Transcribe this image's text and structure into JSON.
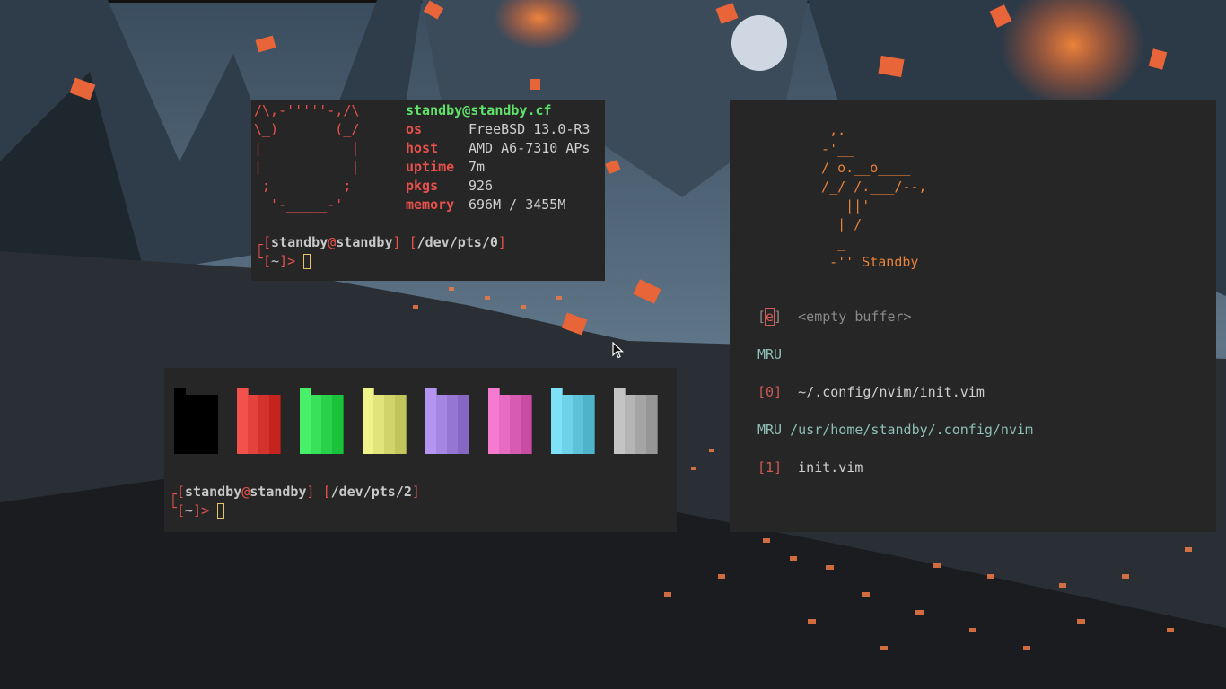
{
  "fetch": {
    "ascii": [
      "/\\,-'''''-,/\\",
      "\\_)       (_/",
      "|           |",
      "|           |",
      " ;         ;",
      "  '-_____-'"
    ],
    "user_host": "standby@standby.cf",
    "rows": [
      {
        "key": "os",
        "value": "FreeBSD 13.0-R3"
      },
      {
        "key": "host",
        "value": "AMD A6-7310 APs"
      },
      {
        "key": "uptime",
        "value": "7m"
      },
      {
        "key": "pkgs",
        "value": "926"
      },
      {
        "key": "memory",
        "value": "696M / 3455M"
      }
    ],
    "prompt": {
      "user": "standby",
      "host": "standby",
      "tty": "/dev/pts/0",
      "cwd": "~"
    }
  },
  "palette": {
    "colors": [
      "#000000",
      "#f2514c",
      "#48f06a",
      "#f0f38a",
      "#b595f2",
      "#f57ad0",
      "#7de2f7",
      "#c4c4c4"
    ],
    "prompt": {
      "user": "standby",
      "host": "standby",
      "tty": "/dev/pts/2",
      "cwd": "~"
    }
  },
  "nvim": {
    "logo": [
      "   ,.",
      "  -'__",
      "  / o.__o____",
      "  /_/ /.___/--,",
      "     ||'",
      "    | /",
      "    _",
      "   -'' Standby"
    ],
    "empty_key": "e",
    "empty_label": "<empty buffer>",
    "mru_heading": "MRU",
    "mru_item_index": "0",
    "mru_item_path": "~/.config/nvim/init.vim",
    "mru_dir_heading": "MRU /usr/home/standby/.config/nvim",
    "dir_item_index": "1",
    "dir_item_name": "init.vim"
  }
}
